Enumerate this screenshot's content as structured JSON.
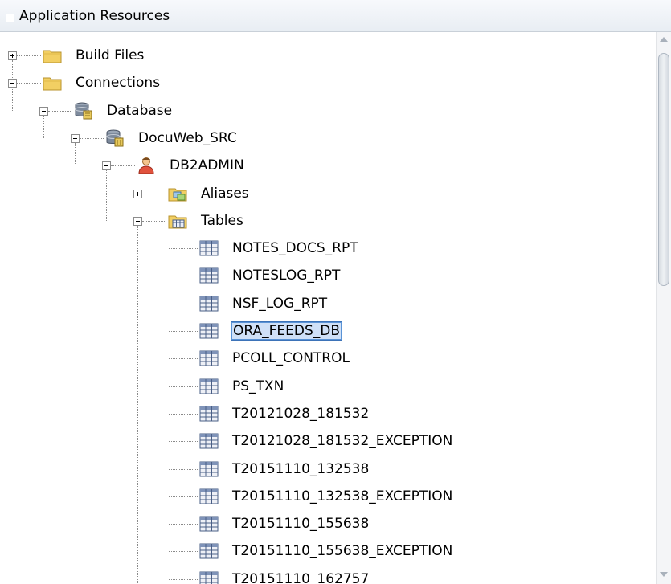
{
  "header": {
    "title": "Application Resources"
  },
  "tree": [
    {
      "id": "build-files",
      "label": "Build Files",
      "depth": 0,
      "icon": "folder-icon",
      "expander": "plus"
    },
    {
      "id": "connections",
      "label": "Connections",
      "depth": 0,
      "icon": "folder-icon",
      "expander": "minus"
    },
    {
      "id": "database",
      "label": "Database",
      "depth": 1,
      "icon": "database-icon",
      "expander": "minus"
    },
    {
      "id": "docuweb-src",
      "label": "DocuWeb_SRC",
      "depth": 2,
      "icon": "database-connection-icon",
      "expander": "minus"
    },
    {
      "id": "db2admin",
      "label": "DB2ADMIN",
      "depth": 3,
      "icon": "schema-user-icon",
      "expander": "minus"
    },
    {
      "id": "aliases",
      "label": "Aliases",
      "depth": 4,
      "icon": "aliases-folder-icon",
      "expander": "plus"
    },
    {
      "id": "tables",
      "label": "Tables",
      "depth": 4,
      "icon": "tables-folder-icon",
      "expander": "minus"
    },
    {
      "id": "t1",
      "label": "NOTES_DOCS_RPT",
      "depth": 5,
      "icon": "table-icon",
      "expander": "none"
    },
    {
      "id": "t2",
      "label": "NOTESLOG_RPT",
      "depth": 5,
      "icon": "table-icon",
      "expander": "none"
    },
    {
      "id": "t3",
      "label": "NSF_LOG_RPT",
      "depth": 5,
      "icon": "table-icon",
      "expander": "none"
    },
    {
      "id": "t4",
      "label": "ORA_FEEDS_DB",
      "depth": 5,
      "icon": "table-icon",
      "expander": "none",
      "selected": true
    },
    {
      "id": "t5",
      "label": "PCOLL_CONTROL",
      "depth": 5,
      "icon": "table-icon",
      "expander": "none"
    },
    {
      "id": "t6",
      "label": "PS_TXN",
      "depth": 5,
      "icon": "table-icon",
      "expander": "none"
    },
    {
      "id": "t7",
      "label": "T20121028_181532",
      "depth": 5,
      "icon": "table-icon",
      "expander": "none"
    },
    {
      "id": "t8",
      "label": "T20121028_181532_EXCEPTION",
      "depth": 5,
      "icon": "table-icon",
      "expander": "none"
    },
    {
      "id": "t9",
      "label": "T20151110_132538",
      "depth": 5,
      "icon": "table-icon",
      "expander": "none"
    },
    {
      "id": "t10",
      "label": "T20151110_132538_EXCEPTION",
      "depth": 5,
      "icon": "table-icon",
      "expander": "none"
    },
    {
      "id": "t11",
      "label": "T20151110_155638",
      "depth": 5,
      "icon": "table-icon",
      "expander": "none"
    },
    {
      "id": "t12",
      "label": "T20151110_155638_EXCEPTION",
      "depth": 5,
      "icon": "table-icon",
      "expander": "none"
    },
    {
      "id": "t13",
      "label": "T20151110_162757",
      "depth": 5,
      "icon": "table-icon",
      "expander": "none"
    }
  ],
  "colors": {
    "selection_fill": "#cfe0f7",
    "selection_border": "#3d73b8",
    "folder": "#f2cf63"
  }
}
